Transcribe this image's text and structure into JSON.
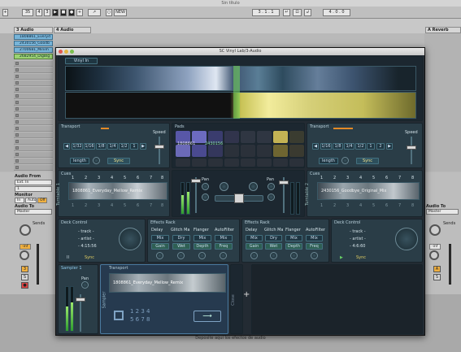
{
  "host": {
    "title": "Sin título",
    "transport": {
      "tempo": "35",
      "sig_num": "4",
      "sig_den": "3",
      "quant": "NEW",
      "position": "3 . 1 . 1",
      "loop_len": "4 . 0 . 0"
    },
    "tracks": {
      "headers": [
        "3 Audio",
        "4 Audio",
        "A Reverb"
      ],
      "clips": [
        "1808861_Everyd",
        "2430156_Goodb",
        "2700681_Minim",
        "2682954_DigBig"
      ],
      "audio_from_label": "Audio From",
      "audio_from_value": "Ext. In",
      "input_value": "1",
      "monitor_label": "Monitor",
      "monitor_opts": [
        "In",
        "Auto",
        "Off"
      ],
      "audio_to_label": "Audio To",
      "audio_to_value": "Master",
      "sends_label": "Sends",
      "send_vals": [
        "-inf",
        "-inf"
      ],
      "track_num": "3",
      "right_track_letter": "A",
      "solo": "S",
      "drop_hint": "Deposite aquí los efectos de audio"
    }
  },
  "plugin": {
    "title": "SC Vinyl Lab/3-Audio",
    "vinyl_in": "Vinyl In",
    "transport_label": "Transport",
    "speed_label": "Speed",
    "loop_sizes": [
      "1/32",
      "1/16",
      "1/8",
      "1/4",
      "1/2",
      "1"
    ],
    "loop_sizes_right": [
      "1/16",
      "1/8",
      "1/4",
      "1/2",
      "1",
      "2"
    ],
    "length_label": "length",
    "sync_label": "Sync",
    "pads_label": "Pads",
    "pad_text_left": "1808861",
    "pad_text_mid": "2430156",
    "cues_label": "Cues",
    "cue_numbers": [
      "1",
      "2",
      "3",
      "4",
      "5",
      "6",
      "7",
      "8"
    ],
    "cue_numbers_b": [
      "1",
      "2",
      "3",
      "4",
      "5",
      "6",
      "7",
      "8"
    ],
    "cue_clip_left": "1808861_Everyday_Mellow_Remix",
    "cue_clip_right": "2430156_Goodbye_Original_Mix",
    "pan_label": "Pan",
    "deck_control_label": "Deck Control",
    "deck_left": {
      "track": "- track -",
      "artist": "- artist -",
      "time": "- 4:15:56"
    },
    "deck_right": {
      "track": "- track -",
      "artist": "- artist -",
      "time": "- 4:6:60"
    },
    "effects_label": "Effects Rack",
    "fx_names": [
      "Delay",
      "Glitch Ma",
      "Flanger",
      "AutoFilter"
    ],
    "fx_params": [
      "Mix",
      "Dry",
      "Mix",
      "Mix"
    ],
    "fx_params2": [
      "Gain",
      "Wet",
      "Depth",
      "Freq"
    ],
    "turntable_1": "Turntable 1",
    "turntable_2": "Turntable 2",
    "sampler_label": "Sampler 1",
    "sampler_transport": "Transport",
    "sampler_clip": "1808861_Everyday_Mellow_Remix",
    "sampler_tab": "Sampler",
    "sampler_numbers_a": "1 2 3 4",
    "sampler_numbers_b": "5 6 7 8",
    "close_label": "Close",
    "add_symbol": "+",
    "pause_symbol": "II",
    "play_symbol": "▶"
  }
}
